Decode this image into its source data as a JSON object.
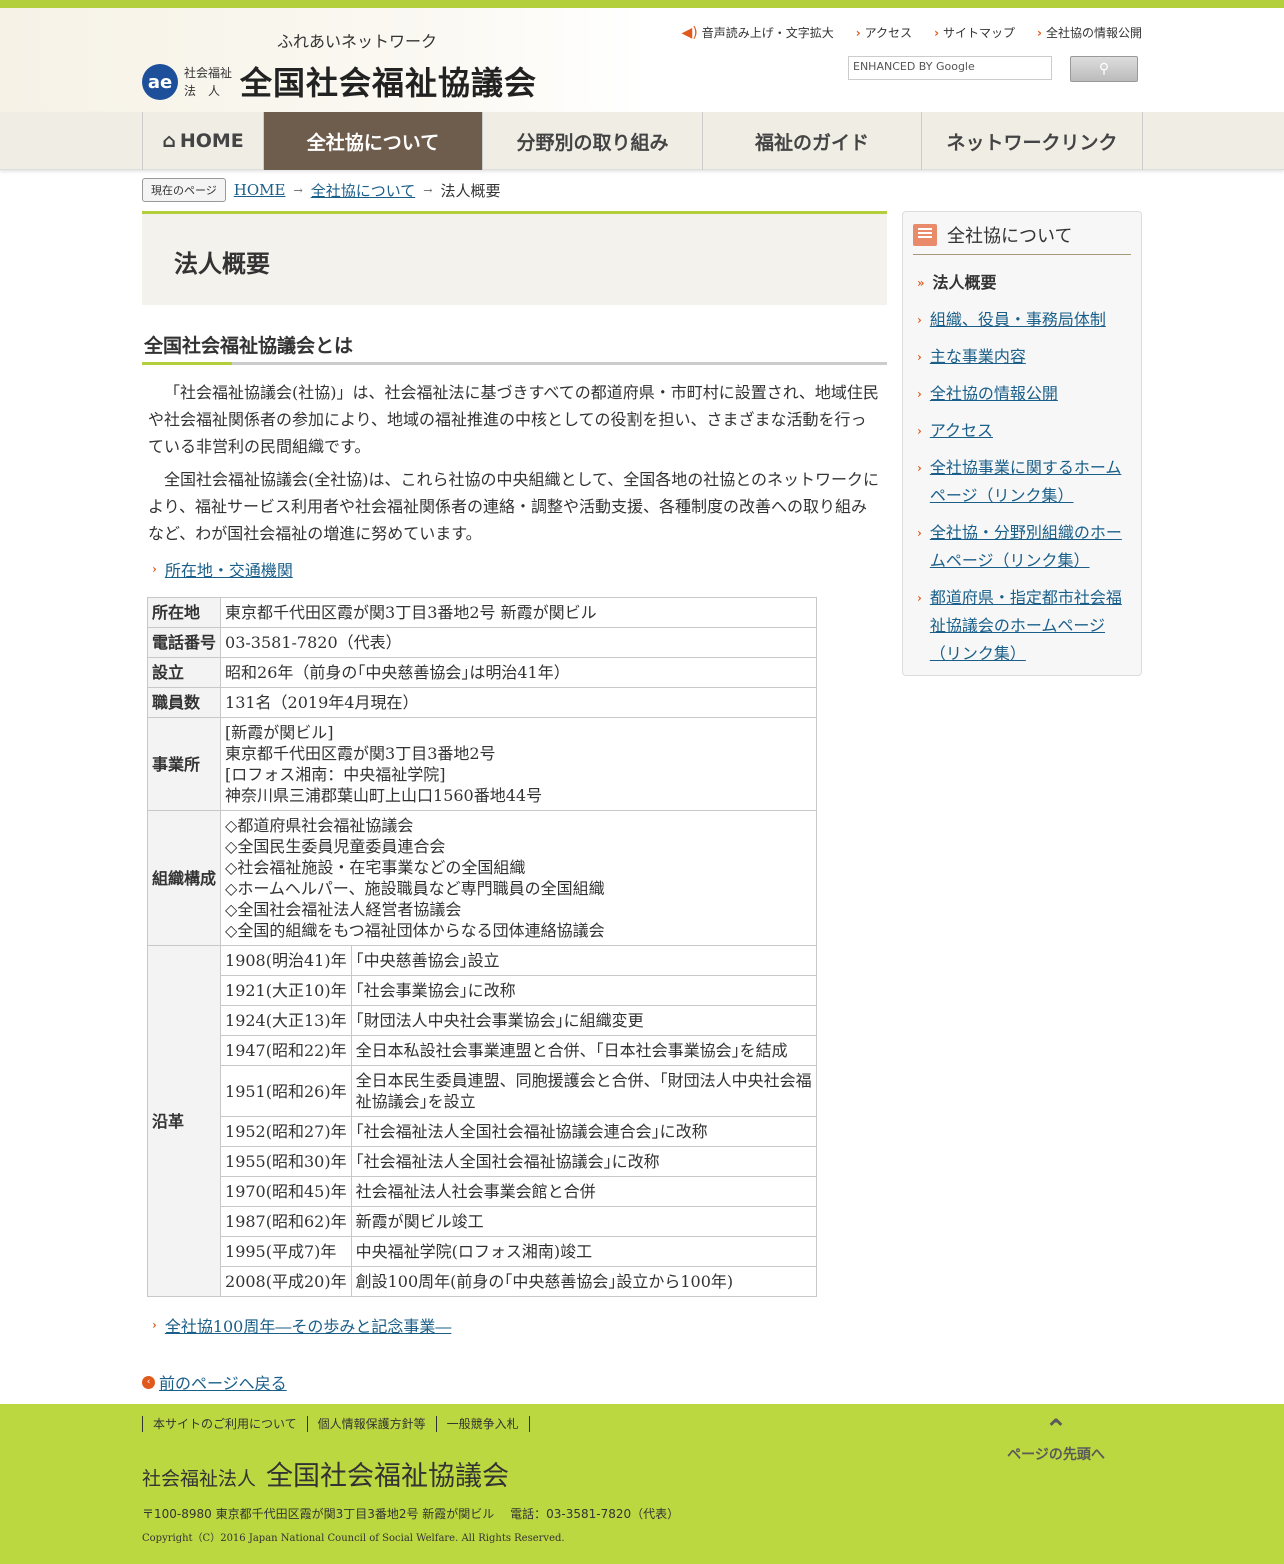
{
  "header": {
    "catch": "ふれあいネットワーク",
    "emblem": "ae",
    "sub_label": "社会福祉 法　人",
    "org_name": "全国社会福祉協議会",
    "util_nav": [
      "音声読み上げ・文字拡大",
      "アクセス",
      "サイトマップ",
      "全社協の情報公開"
    ],
    "search_placeholder": "ENHANCED BY Google"
  },
  "gnav": [
    {
      "label": "HOME",
      "active": false
    },
    {
      "label": "全社協について",
      "active": true
    },
    {
      "label": "分野別の取り組み",
      "active": false
    },
    {
      "label": "福祉のガイド",
      "active": false
    },
    {
      "label": "ネットワークリンク",
      "active": false
    }
  ],
  "breadcrumb": {
    "badge": "現在のページ",
    "items": [
      "HOME",
      "全社協について",
      "法人概要"
    ]
  },
  "main": {
    "title": "法人概要",
    "heading": "全国社会福祉協議会とは",
    "para1": "「社会福祉協議会(社協)」は、社会福祉法に基づきすべての都道府県・市町村に設置され、地域住民や社会福祉関係者の参加により、地域の福祉推進の中核としての役割を担い、さまざまな活動を行っている非営利の民間組織です。",
    "para2": "全国社会福祉協議会(全社協)は、これら社協の中央組織として、全国各地の社協とのネットワークにより、福祉サービス利用者や社会福祉関係者の連絡・調整や活動支援、各種制度の改善への取り組みなど、わが国社会福祉の増進に努めています。",
    "location_link": "所在地・交通機関",
    "table": {
      "address_label": "所在地",
      "address": "東京都千代田区霞が関3丁目3番地2号 新霞が関ビル",
      "phone_label": "電話番号",
      "phone": "03-3581-7820（代表）",
      "founded_label": "設立",
      "founded": "昭和26年（前身の｢中央慈善協会｣は明治41年）",
      "staff_label": "職員数",
      "staff": "131名（2019年4月現在）",
      "offices_label": "事業所",
      "offices": [
        "[新霞が関ビル]",
        "東京都千代田区霞が関3丁目3番地2号",
        "[ロフォス湘南：中央福祉学院]",
        "神奈川県三浦郡葉山町上山口1560番地44号"
      ],
      "org_label": "組織構成",
      "org": [
        "◇都道府県社会福祉協議会",
        "◇全国民生委員児童委員連合会",
        "◇社会福祉施設・在宅事業などの全国組織",
        "◇ホームヘルパー、施設職員など専門職員の全国組織",
        "◇全国社会福祉法人経営者協議会",
        "◇全国的組織をもつ福祉団体からなる団体連絡協議会"
      ],
      "history_label": "沿革",
      "history": [
        {
          "year": "1908(明治41)年",
          "event": "｢中央慈善協会｣設立"
        },
        {
          "year": "1921(大正10)年",
          "event": "｢社会事業協会｣に改称"
        },
        {
          "year": "1924(大正13)年",
          "event": "｢財団法人中央社会事業協会｣に組織変更"
        },
        {
          "year": "1947(昭和22)年",
          "event": "全日本私設社会事業連盟と合併、｢日本社会事業協会｣を結成"
        },
        {
          "year": "1951(昭和26)年",
          "event": "全日本民生委員連盟、同胞援護会と合併、｢財団法人中央社会福祉協議会｣を設立"
        },
        {
          "year": "1952(昭和27)年",
          "event": "｢社会福祉法人全国社会福祉協議会連合会｣に改称"
        },
        {
          "year": "1955(昭和30)年",
          "event": "｢社会福祉法人全国社会福祉協議会｣に改称"
        },
        {
          "year": "1970(昭和45)年",
          "event": "社会福祉法人社会事業会館と合併"
        },
        {
          "year": "1987(昭和62)年",
          "event": "新霞が関ビル竣工"
        },
        {
          "year": "1995(平成7)年",
          "event": "中央福祉学院(ロフォス湘南)竣工"
        },
        {
          "year": "2008(平成20)年",
          "event": "創設100周年(前身の｢中央慈善協会｣設立から100年)"
        }
      ]
    },
    "centennial_link": "全社協100周年―その歩みと記念事業―",
    "back_link": "前のページへ戻る"
  },
  "sidebar": {
    "title": "全社協について",
    "items": [
      {
        "label": "法人概要",
        "current": true
      },
      {
        "label": "組織、役員・事務局体制",
        "current": false
      },
      {
        "label": "主な事業内容",
        "current": false
      },
      {
        "label": "全社協の情報公開",
        "current": false
      },
      {
        "label": "アクセス",
        "current": false
      },
      {
        "label": "全社協事業に関するホームページ（リンク集）",
        "current": false
      },
      {
        "label": "全社協・分野別組織のホームページ（リンク集）",
        "current": false
      },
      {
        "label": "都道府県・指定都市社会福祉協議会のホームページ（リンク集）",
        "current": false
      }
    ]
  },
  "footer": {
    "nav": [
      "本サイトのご利用について",
      "個人情報保護方針等",
      "一般競争入札"
    ],
    "org_small": "社会福祉法人",
    "org_big": "全国社会福祉協議会",
    "address": "〒100-8980 東京都千代田区霞が関3丁目3番地2号 新霞が関ビル　 電話：03-3581-7820（代表）",
    "copyright": "Copyright（C）2016 Japan National Council of Social Welfare. All Rights Reserved.",
    "pagetop": "ページの先頭へ"
  },
  "colors": {
    "accent_green": "#b3cf3b",
    "nav_active": "#6e5d4c",
    "link_blue": "#1a5f8a",
    "chevron_orange": "#e05a1e"
  }
}
